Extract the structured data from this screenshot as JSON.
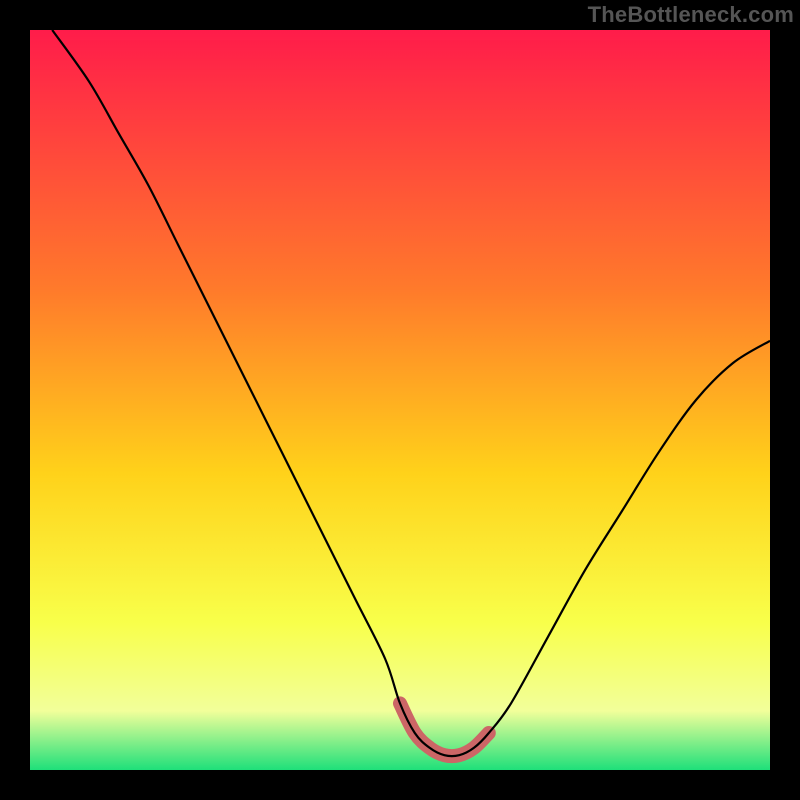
{
  "watermark": "TheBottleneck.com",
  "colors": {
    "top": "#ff1c4a",
    "mid1": "#ff7a2b",
    "mid2": "#ffd21a",
    "mid3": "#f8ff4a",
    "bottom_yellow": "#f2ff9a",
    "bottom_green": "#1ee07a",
    "curve": "#000000",
    "highlight": "#cc6666",
    "frame": "#000000"
  },
  "chart_data": {
    "type": "line",
    "title": "",
    "xlabel": "",
    "ylabel": "",
    "xlim": [
      0,
      100
    ],
    "ylim": [
      0,
      100
    ],
    "series": [
      {
        "name": "bottleneck-curve",
        "x": [
          3,
          8,
          12,
          16,
          20,
          24,
          28,
          32,
          36,
          40,
          44,
          48,
          50,
          52,
          54,
          56,
          58,
          60,
          62,
          65,
          70,
          75,
          80,
          85,
          90,
          95,
          100
        ],
        "y": [
          100,
          93,
          86,
          79,
          71,
          63,
          55,
          47,
          39,
          31,
          23,
          15,
          9,
          5,
          3,
          2,
          2,
          3,
          5,
          9,
          18,
          27,
          35,
          43,
          50,
          55,
          58
        ]
      }
    ],
    "highlight_range_x": [
      50,
      62
    ],
    "annotations": []
  }
}
